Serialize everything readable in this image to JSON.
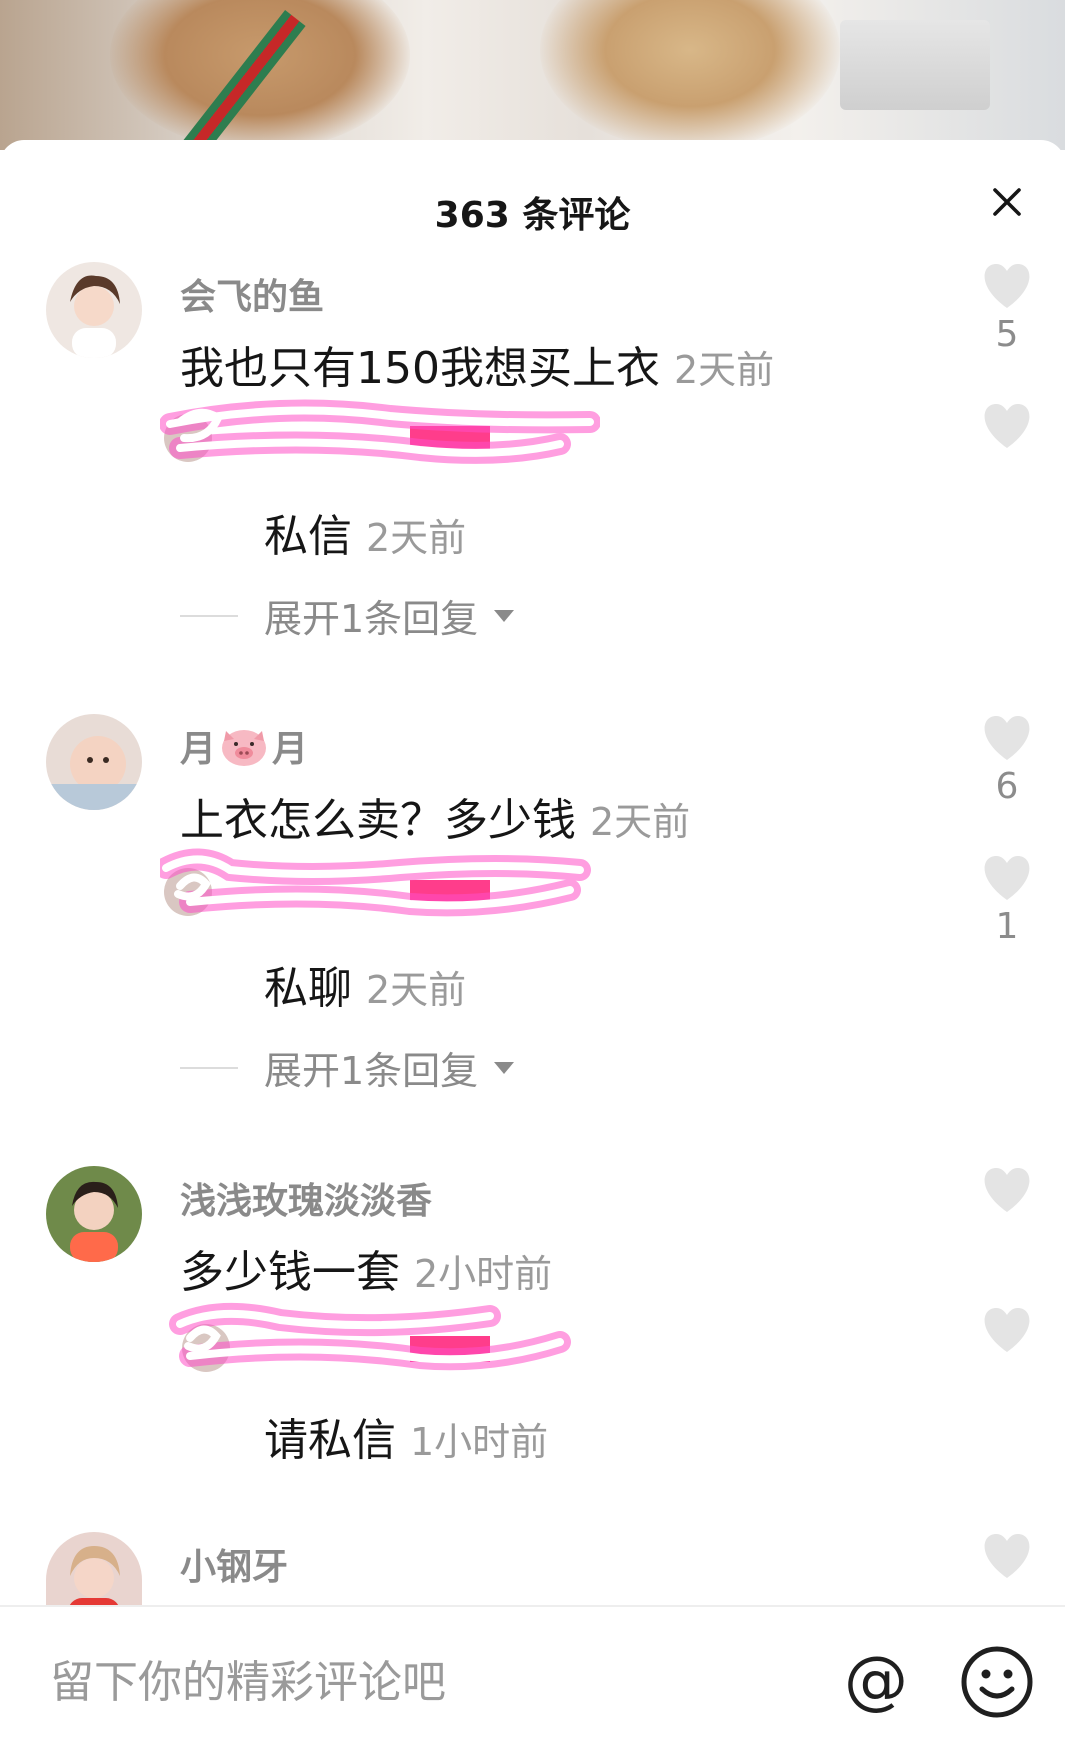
{
  "header": {
    "title": "363 条评论",
    "close_icon": "close-icon"
  },
  "comments": [
    {
      "username": "会飞的鱼",
      "text": "我也只有150我想买上衣",
      "time": "2天前",
      "likes": "5",
      "reply": {
        "text": "私信",
        "time": "2天前",
        "likes": ""
      },
      "expand_label": "展开1条回复"
    },
    {
      "username": "月",
      "username_suffix": "月",
      "username_emoji": "pig-face-icon",
      "text": "上衣怎么卖？多少钱",
      "time": "2天前",
      "likes": "6",
      "reply": {
        "text": "私聊",
        "time": "2天前",
        "likes": "1"
      },
      "expand_label": "展开1条回复"
    },
    {
      "username": "浅浅玫瑰淡淡香",
      "text": "多少钱一套",
      "time": "2小时前",
      "likes": "",
      "reply": {
        "text": "请私信",
        "time": "1小时前",
        "likes": ""
      }
    },
    {
      "username": "小钢牙"
    }
  ],
  "input": {
    "placeholder": "留下你的精彩评论吧"
  },
  "colors": {
    "scribble": "#ff4fc8",
    "like_icon": "#e4e4e4",
    "text_primary": "#161616",
    "text_secondary": "#8a8a8a"
  }
}
